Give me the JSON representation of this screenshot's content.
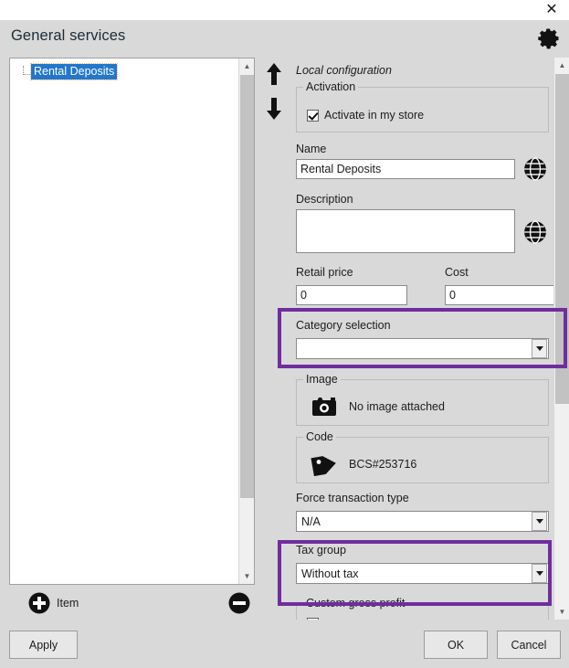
{
  "window": {
    "title": "General services",
    "close_label": "✕",
    "gear_icon": "gear-icon"
  },
  "tree": {
    "nodes": [
      {
        "label": "Rental Deposits",
        "selected": true
      }
    ]
  },
  "reorder": {
    "up_icon": "arrow-up-icon",
    "down_icon": "arrow-down-icon"
  },
  "config": {
    "heading": "Local configuration",
    "activation": {
      "group_title": "Activation",
      "checkbox_label": "Activate in my store",
      "checked": true
    },
    "name": {
      "label": "Name",
      "value": "Rental Deposits",
      "translate_icon": "globe-icon"
    },
    "description": {
      "label": "Description",
      "value": "",
      "translate_icon": "globe-icon"
    },
    "retail_price": {
      "label": "Retail price",
      "value": "0"
    },
    "cost": {
      "label": "Cost",
      "value": "0"
    },
    "category_selection": {
      "label": "Category selection",
      "value": "",
      "highlighted": true
    },
    "image": {
      "group_title": "Image",
      "status_text": "No image attached",
      "icon": "camera-icon"
    },
    "code": {
      "group_title": "Code",
      "value": "BCS#253716",
      "icon": "tag-icon"
    },
    "force_transaction_type": {
      "label": "Force transaction type",
      "value": "N/A"
    },
    "tax_group": {
      "label": "Tax group",
      "value": "Without tax",
      "highlighted": true
    },
    "custom_gross_profit": {
      "group_title": "Custom gross profit"
    }
  },
  "item_bar": {
    "add_icon": "plus-circle-icon",
    "add_label": "Item",
    "remove_icon": "minus-circle-icon"
  },
  "footer": {
    "apply": "Apply",
    "ok": "OK",
    "cancel": "Cancel"
  },
  "colors": {
    "highlight": "#702d9e",
    "selection": "#2277cc",
    "window_bg": "#d9d9d9"
  }
}
